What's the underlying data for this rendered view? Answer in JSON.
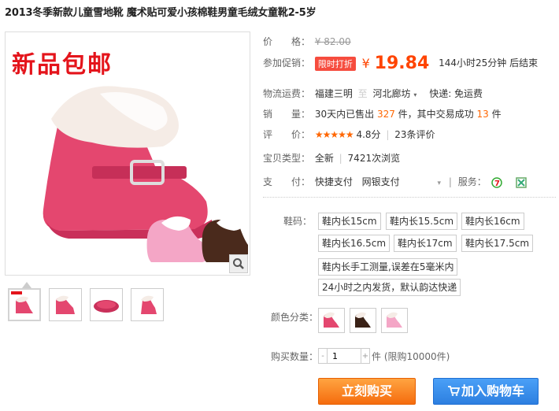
{
  "title": "2013冬季新款儿童雪地靴 魔术贴可爱小孩棉鞋男童毛绒女童靴2-5岁",
  "gallery": {
    "promo_overlay": "新品包邮",
    "zoom_icon": "magnifier-icon",
    "thumbnail_count": 4
  },
  "price": {
    "label": "价　　格：",
    "original": "¥ 82.00"
  },
  "promotion": {
    "label": "参加促销：",
    "badge": "限时打折",
    "yen": "¥",
    "price": "19.84",
    "countdown": "144小时25分钟 后结束"
  },
  "shipping": {
    "label": "物流运费：",
    "from": "福建三明",
    "sep": "至",
    "to": "河北廊坊",
    "fee": "快递: 免运费"
  },
  "sales": {
    "label": "销　　量：",
    "prefix": "30天内已售出",
    "sold": "327",
    "mid": "件，其中交易成功",
    "success": "13",
    "suffix": "件"
  },
  "rating": {
    "label": "评　　价：",
    "stars": "★★★★★",
    "score": "4.8分",
    "count": "23条评价"
  },
  "type": {
    "label": "宝贝类型：",
    "condition": "全新",
    "views": "7421次浏览"
  },
  "payment": {
    "label": "支　　付：",
    "method1": "快捷支付",
    "method2": "网银支付",
    "service_label": "服务："
  },
  "options": {
    "size_label": "鞋码：",
    "sizes": [
      "鞋内长15cm",
      "鞋内长15.5cm",
      "鞋内长16cm",
      "鞋内长16.5cm",
      "鞋内长17cm",
      "鞋内长17.5cm",
      "鞋内长手工测量,误差在5毫米内",
      "24小时之内发货，默认韵达快递"
    ],
    "color_label": "颜色分类：",
    "qty_label": "购买数量：",
    "qty_value": "1",
    "qty_suffix": "件 (限购10000件)"
  },
  "buttons": {
    "buy_now": "立刻购买",
    "add_cart": "加入购物车"
  },
  "colors": {
    "accent": "#ff4400",
    "buy": "#f56c0e",
    "cart": "#2d7fe0"
  }
}
